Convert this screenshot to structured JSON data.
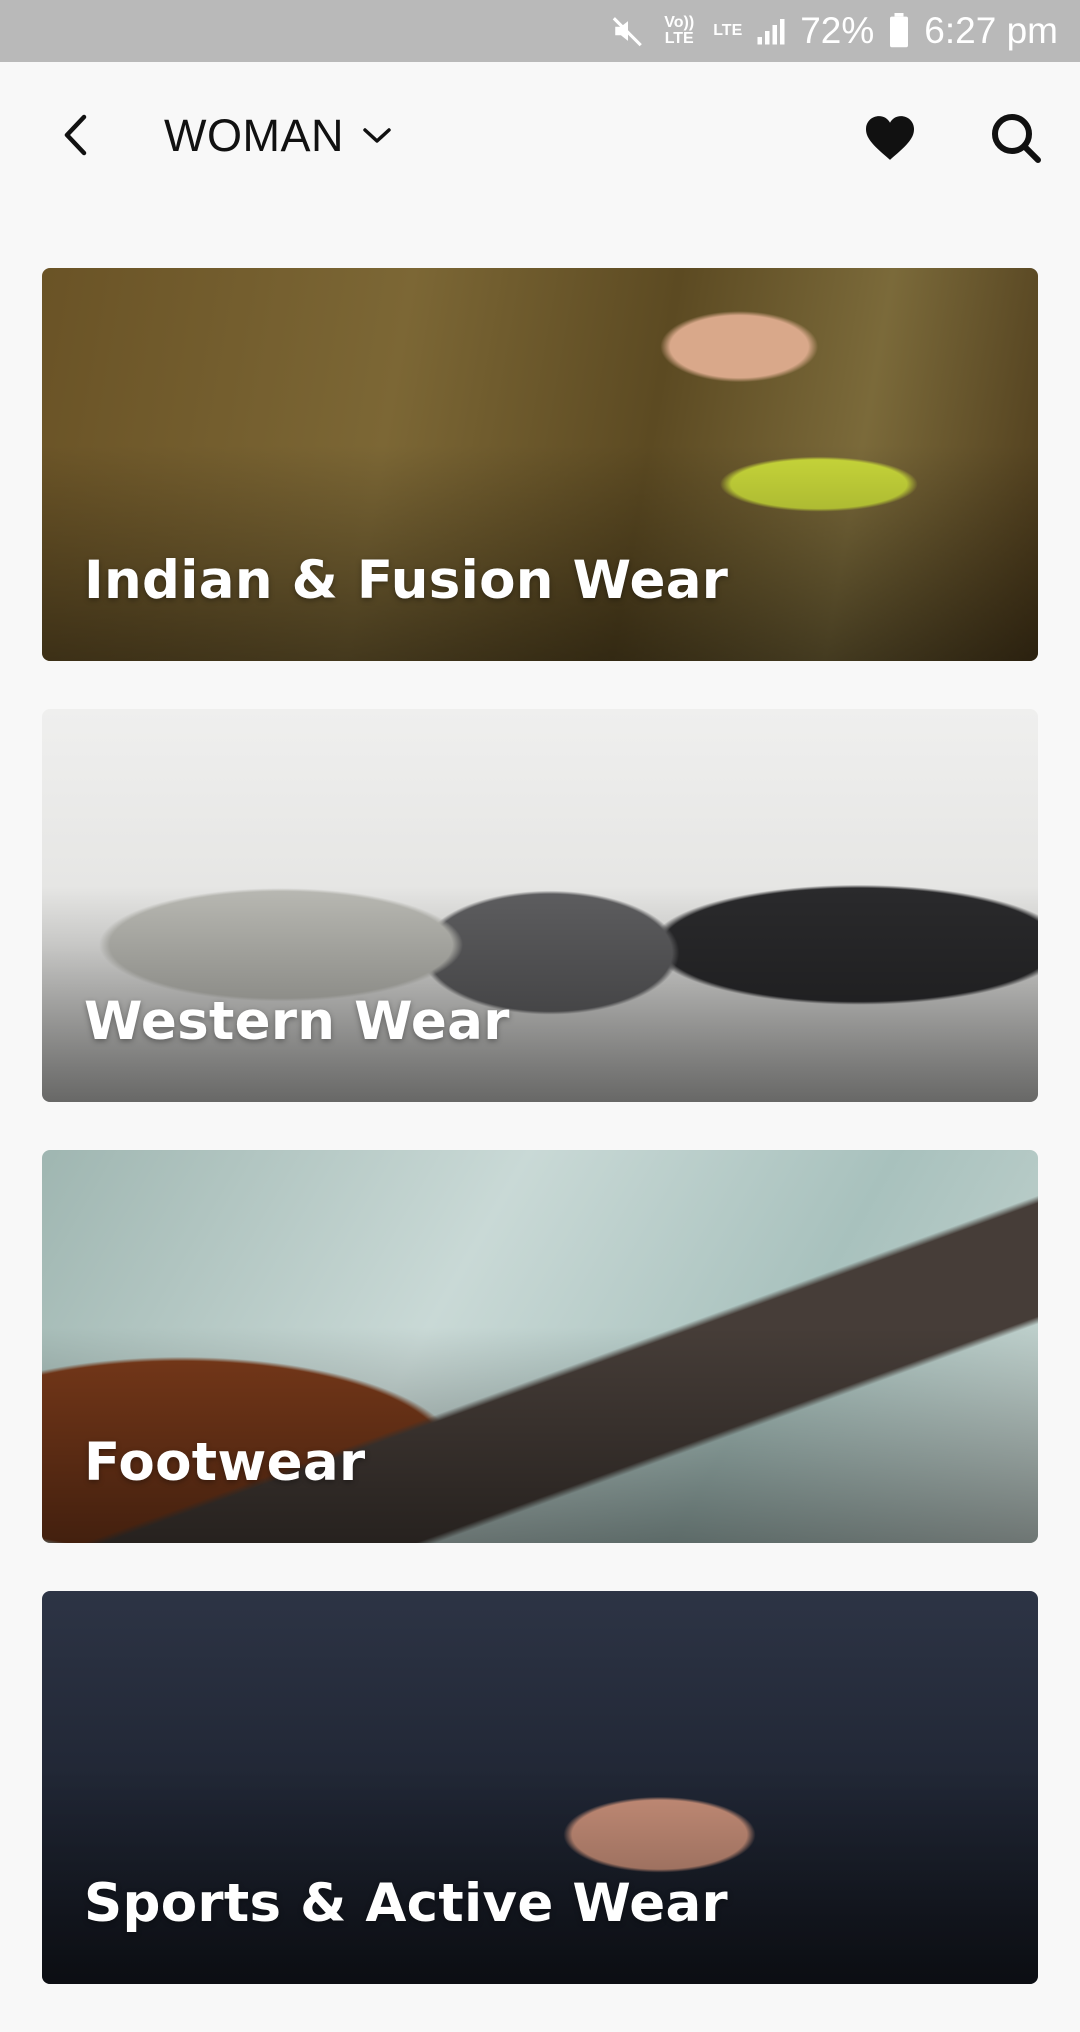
{
  "status_bar": {
    "lte_top": "Vo)) LTE",
    "lte2": "LTE",
    "battery": "72%",
    "time": "6:27 pm"
  },
  "header": {
    "title": "WOMAN"
  },
  "colors": {
    "background": "#f8f8f8",
    "status_bar": "#b9b9b9",
    "text": "#111111",
    "card_label": "#ffffff"
  },
  "icons": [
    "back-arrow-icon",
    "chevron-down-icon",
    "heart-icon",
    "search-icon",
    "mute-icon",
    "signal-icon",
    "battery-icon"
  ],
  "categories": [
    {
      "label": "Indian & Fusion Wear"
    },
    {
      "label": "Western Wear"
    },
    {
      "label": "Footwear"
    },
    {
      "label": "Sports & Active Wear"
    }
  ]
}
